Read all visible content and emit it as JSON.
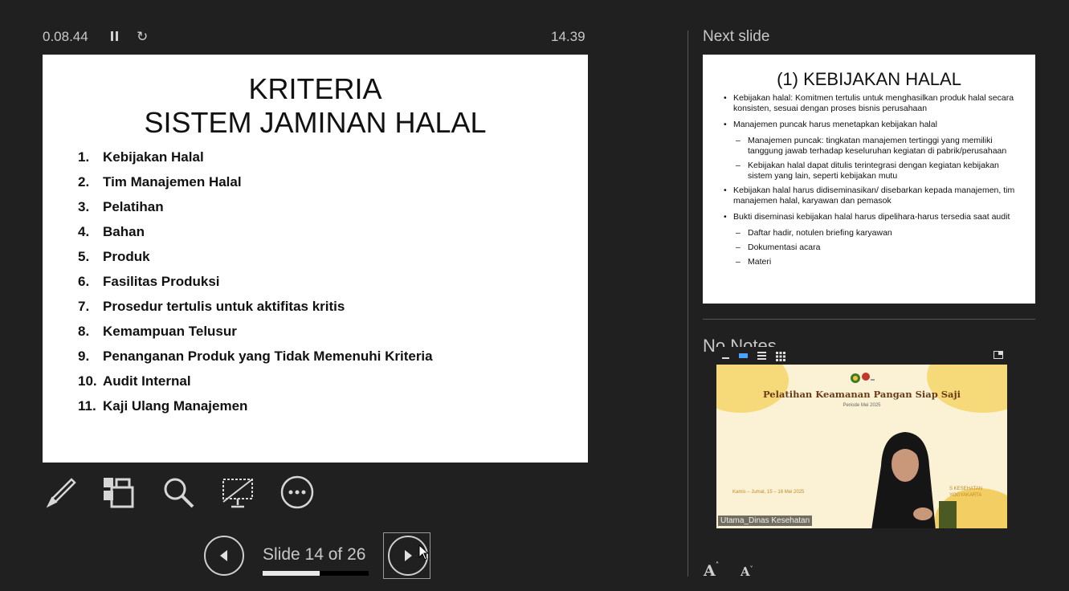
{
  "top": {
    "elapsed": "0.08.44",
    "clock": "14.39"
  },
  "current_slide": {
    "title_line1": "KRITERIA",
    "title_line2": "SISTEM JAMINAN HALAL",
    "items": [
      {
        "num": "1.",
        "text": "Kebijakan Halal"
      },
      {
        "num": "2.",
        "text": "Tim Manajemen Halal"
      },
      {
        "num": "3.",
        "text": "Pelatihan"
      },
      {
        "num": "4.",
        "text": "Bahan"
      },
      {
        "num": "5.",
        "text": "Produk"
      },
      {
        "num": "6.",
        "text": "Fasilitas Produksi"
      },
      {
        "num": "7.",
        "text": "Prosedur tertulis untuk aktifitas kritis"
      },
      {
        "num": "8.",
        "text": "Kemampuan Telusur"
      },
      {
        "num": "9.",
        "text": "Penanganan Produk yang Tidak Memenuhi Kriteria"
      },
      {
        "num": "10.",
        "text": "Audit Internal"
      },
      {
        "num": "11.",
        "text": "Kaji Ulang Manajemen"
      }
    ]
  },
  "toolbar": {
    "icons": [
      "pen-icon",
      "see-all-slides-icon",
      "zoom-icon",
      "black-screen-icon",
      "more-options-icon"
    ]
  },
  "navigation": {
    "counter": "Slide 14 of 26",
    "current": 14,
    "total": 26
  },
  "next_slide": {
    "label": "Next slide",
    "title": "(1) KEBIJAKAN HALAL",
    "b1": "Kebijakan halal: Komitmen tertulis untuk menghasilkan produk halal secara konsisten, sesuai dengan proses bisnis perusahaan",
    "b2": "Manajemen puncak harus menetapkan kebijakan halal",
    "b2s1": "Manajemen puncak: tingkatan manajemen tertinggi yang memiliki tanggung jawab terhadap keseluruhan kegiatan di pabrik/perusahaan",
    "b2s2": "Kebijakan halal dapat ditulis terintegrasi dengan kegiatan kebijakan sistem yang lain, seperti kebijakan mutu",
    "b3": "Kebijakan halal harus didiseminasikan/ disebarkan kepada manajemen, tim manajemen halal, karyawan dan pemasok",
    "b4": "Bukti diseminasi kebijakan halal harus dipelihara-harus tersedia saat audit",
    "b4s1": "Daftar hadir, notulen briefing karyawan",
    "b4s2": "Dokumentasi acara",
    "b4s3": "Materi"
  },
  "notes": {
    "label": "No Notes"
  },
  "video": {
    "title": "Pelatihan Keamanan Pangan Siap Saji",
    "period": "Periode Mei 2025",
    "dates": "Kamis – Jumat, 15 – 16 Mei 2025",
    "org_line1": "S KESEHATAN",
    "org_line2": "YOGYAKARTA",
    "participant": "Utama_Dinas Kesehatan"
  },
  "colors": {
    "background": "#202020",
    "text": "#c8c8c8",
    "slide_bg": "#ffffff"
  }
}
